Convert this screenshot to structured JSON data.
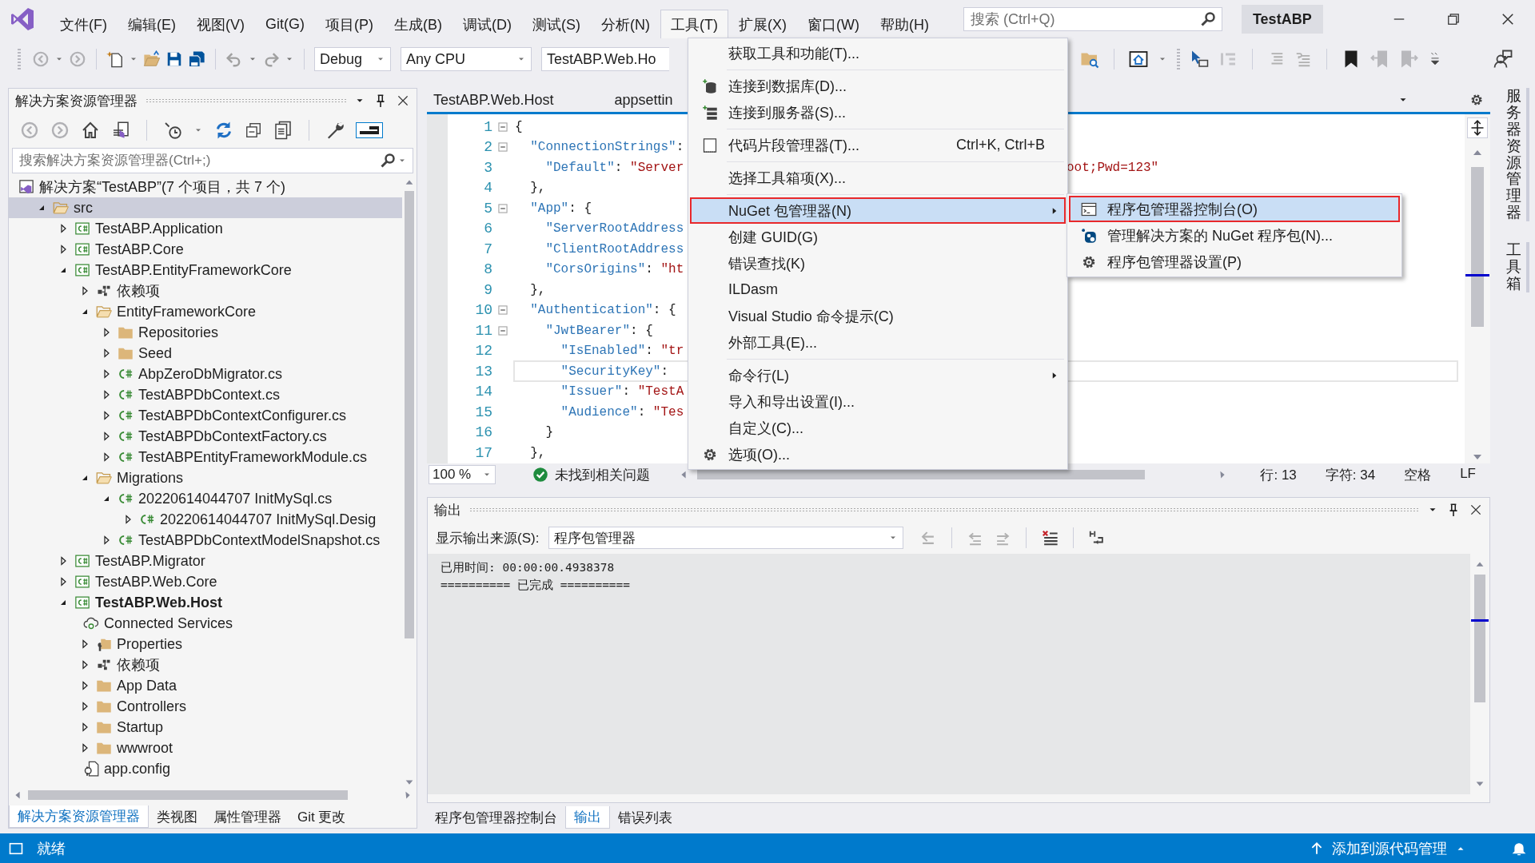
{
  "title_bar": {
    "menus": [
      {
        "label": "文件(F)",
        "selected": false
      },
      {
        "label": "编辑(E)",
        "selected": false
      },
      {
        "label": "视图(V)",
        "selected": false
      },
      {
        "label": "Git(G)",
        "selected": false
      },
      {
        "label": "项目(P)",
        "selected": false
      },
      {
        "label": "生成(B)",
        "selected": false
      },
      {
        "label": "调试(D)",
        "selected": false
      },
      {
        "label": "测试(S)",
        "selected": false
      },
      {
        "label": "分析(N)",
        "selected": false
      },
      {
        "label": "工具(T)",
        "selected": true
      },
      {
        "label": "扩展(X)",
        "selected": false
      },
      {
        "label": "窗口(W)",
        "selected": false
      },
      {
        "label": "帮助(H)",
        "selected": false
      }
    ],
    "search": {
      "placeholder": "搜索 (Ctrl+Q)"
    },
    "solution_name": "TestABP"
  },
  "toolbar": {
    "configuration": "Debug",
    "platform": "Any CPU",
    "startup_project": "TestABP.Web.Ho"
  },
  "solution_explorer": {
    "title": "解决方案资源管理器",
    "preview_toggle": {
      "on": true
    },
    "search": {
      "placeholder": "搜索解决方案资源管理器(Ctrl+;)"
    },
    "tree": [
      {
        "label": "解决方案“TestABP”(7 个项目，共 7 个)",
        "kind": "solution",
        "selected": false,
        "startup": false,
        "children": [
          {
            "label": "src",
            "kind": "folder",
            "expanded": true,
            "selected": true,
            "startup": false,
            "children": [
              {
                "label": "TestABP.Application",
                "kind": "project",
                "expanded": false,
                "selected": false,
                "startup": false
              },
              {
                "label": "TestABP.Core",
                "kind": "project",
                "expanded": false,
                "selected": false,
                "startup": false
              },
              {
                "label": "TestABP.EntityFrameworkCore",
                "kind": "project",
                "expanded": true,
                "selected": false,
                "startup": false,
                "children": [
                  {
                    "label": "依赖项",
                    "kind": "dependencies",
                    "expanded": false,
                    "selected": false,
                    "startup": false
                  },
                  {
                    "label": "EntityFrameworkCore",
                    "kind": "folder",
                    "expanded": true,
                    "selected": false,
                    "startup": false,
                    "children": [
                      {
                        "label": "Repositories",
                        "kind": "folder",
                        "expanded": false,
                        "selected": false,
                        "startup": false
                      },
                      {
                        "label": "Seed",
                        "kind": "folder",
                        "expanded": false,
                        "selected": false,
                        "startup": false
                      },
                      {
                        "label": "AbpZeroDbMigrator.cs",
                        "kind": "code",
                        "expanded": false,
                        "selected": false,
                        "startup": false
                      },
                      {
                        "label": "TestABPDbContext.cs",
                        "kind": "code",
                        "expanded": false,
                        "selected": false,
                        "startup": false
                      },
                      {
                        "label": "TestABPDbContextConfigurer.cs",
                        "kind": "code",
                        "expanded": false,
                        "selected": false,
                        "startup": false
                      },
                      {
                        "label": "TestABPDbContextFactory.cs",
                        "kind": "code",
                        "expanded": false,
                        "selected": false,
                        "startup": false
                      },
                      {
                        "label": "TestABPEntityFrameworkModule.cs",
                        "kind": "code",
                        "expanded": false,
                        "selected": false,
                        "startup": false
                      }
                    ]
                  },
                  {
                    "label": "Migrations",
                    "kind": "folder",
                    "expanded": true,
                    "selected": false,
                    "startup": false,
                    "children": [
                      {
                        "label": "20220614044707 InitMySql.cs",
                        "kind": "code",
                        "expanded": true,
                        "selected": false,
                        "startup": false,
                        "children": [
                          {
                            "label": "20220614044707 InitMySql.Desig",
                            "kind": "code",
                            "expanded": false,
                            "selected": false,
                            "startup": false
                          }
                        ]
                      },
                      {
                        "label": "TestABPDbContextModelSnapshot.cs",
                        "kind": "code",
                        "expanded": false,
                        "selected": false,
                        "startup": false
                      }
                    ]
                  }
                ]
              },
              {
                "label": "TestABP.Migrator",
                "kind": "project",
                "expanded": false,
                "selected": false,
                "startup": false
              },
              {
                "label": "TestABP.Web.Core",
                "kind": "project",
                "expanded": false,
                "selected": false,
                "startup": false
              },
              {
                "label": "TestABP.Web.Host",
                "kind": "project",
                "expanded": true,
                "selected": false,
                "startup": true,
                "children": [
                  {
                    "label": "Connected Services",
                    "kind": "connected",
                    "selected": false,
                    "startup": false
                  },
                  {
                    "label": "Properties",
                    "kind": "properties",
                    "expanded": false,
                    "selected": false,
                    "startup": false
                  },
                  {
                    "label": "依赖项",
                    "kind": "dependencies",
                    "expanded": false,
                    "selected": false,
                    "startup": false
                  },
                  {
                    "label": "App Data",
                    "kind": "folder",
                    "expanded": false,
                    "selected": false,
                    "startup": false
                  },
                  {
                    "label": "Controllers",
                    "kind": "folder",
                    "expanded": false,
                    "selected": false,
                    "startup": false
                  },
                  {
                    "label": "Startup",
                    "kind": "folder",
                    "expanded": false,
                    "selected": false,
                    "startup": false
                  },
                  {
                    "label": "wwwroot",
                    "kind": "folder",
                    "expanded": false,
                    "selected": false,
                    "startup": false
                  },
                  {
                    "label": "app.config",
                    "kind": "config",
                    "selected": false,
                    "startup": false
                  }
                ]
              }
            ]
          }
        ]
      }
    ],
    "tabs": [
      {
        "label": "解决方案资源管理器",
        "selected": true
      },
      {
        "label": "类视图",
        "selected": false
      },
      {
        "label": "属性管理器",
        "selected": false
      },
      {
        "label": "Git 更改",
        "selected": false
      }
    ]
  },
  "editor": {
    "tabs": [
      {
        "label": "TestABP.Web.Host"
      },
      {
        "label": "appsettin"
      }
    ],
    "lines": [
      {
        "number": "1",
        "fold": true,
        "current": false,
        "segments": [
          {
            "text": "{",
            "kind": "punct"
          }
        ]
      },
      {
        "number": "2",
        "fold": true,
        "current": false,
        "segments": [
          {
            "text": "  \"ConnectionStrings\"",
            "kind": "key"
          },
          {
            "text": ":",
            "kind": "punct"
          }
        ]
      },
      {
        "number": "3",
        "fold": false,
        "current": false,
        "segments": [
          {
            "text": "    \"Default\"",
            "kind": "key"
          },
          {
            "text": ": ",
            "kind": "punct"
          },
          {
            "text": "\"Server",
            "kind": "string"
          }
        ],
        "tail": {
          "text": "oot;Pwd=123\"",
          "kind": "string"
        }
      },
      {
        "number": "4",
        "fold": false,
        "current": false,
        "segments": [
          {
            "text": "  },",
            "kind": "punct"
          }
        ]
      },
      {
        "number": "5",
        "fold": true,
        "current": false,
        "segments": [
          {
            "text": "  \"App\"",
            "kind": "key"
          },
          {
            "text": ": {",
            "kind": "punct"
          }
        ]
      },
      {
        "number": "6",
        "fold": false,
        "current": false,
        "segments": [
          {
            "text": "    \"ServerRootAddress",
            "kind": "key"
          }
        ]
      },
      {
        "number": "7",
        "fold": false,
        "current": false,
        "segments": [
          {
            "text": "    \"ClientRootAddress",
            "kind": "key"
          }
        ]
      },
      {
        "number": "8",
        "fold": false,
        "current": false,
        "segments": [
          {
            "text": "    \"CorsOrigins\"",
            "kind": "key"
          },
          {
            "text": ": ",
            "kind": "punct"
          },
          {
            "text": "\"ht",
            "kind": "string"
          }
        ]
      },
      {
        "number": "9",
        "fold": false,
        "current": false,
        "segments": [
          {
            "text": "  },",
            "kind": "punct"
          }
        ]
      },
      {
        "number": "10",
        "fold": true,
        "current": false,
        "segments": [
          {
            "text": "  \"Authentication\"",
            "kind": "key"
          },
          {
            "text": ": {",
            "kind": "punct"
          }
        ]
      },
      {
        "number": "11",
        "fold": true,
        "current": false,
        "segments": [
          {
            "text": "    \"JwtBearer\"",
            "kind": "key"
          },
          {
            "text": ": {",
            "kind": "punct"
          }
        ]
      },
      {
        "number": "12",
        "fold": false,
        "current": false,
        "segments": [
          {
            "text": "      \"IsEnabled\"",
            "kind": "key"
          },
          {
            "text": ": ",
            "kind": "punct"
          },
          {
            "text": "\"tr",
            "kind": "string"
          }
        ]
      },
      {
        "number": "13",
        "fold": false,
        "current": true,
        "segments": [
          {
            "text": "      \"SecurityKey\"",
            "kind": "key"
          },
          {
            "text": ":",
            "kind": "punct"
          }
        ]
      },
      {
        "number": "14",
        "fold": false,
        "current": false,
        "segments": [
          {
            "text": "      \"Issuer\"",
            "kind": "key"
          },
          {
            "text": ": ",
            "kind": "punct"
          },
          {
            "text": "\"TestA",
            "kind": "string"
          }
        ]
      },
      {
        "number": "15",
        "fold": false,
        "current": false,
        "segments": [
          {
            "text": "      \"Audience\"",
            "kind": "key"
          },
          {
            "text": ": ",
            "kind": "punct"
          },
          {
            "text": "\"Tes",
            "kind": "string"
          }
        ]
      },
      {
        "number": "16",
        "fold": false,
        "current": false,
        "segments": [
          {
            "text": "    }",
            "kind": "punct"
          }
        ]
      },
      {
        "number": "17",
        "fold": false,
        "current": false,
        "segments": [
          {
            "text": "  },",
            "kind": "punct"
          }
        ]
      }
    ],
    "zoom": "100 %",
    "issues": "未找到相关问题",
    "position": {
      "line": "行: 13",
      "column": "字符: 34",
      "indent": "空格",
      "line_ending": "LF"
    }
  },
  "output": {
    "title": "输出",
    "source_label": "显示输出来源(S):",
    "source": "程序包管理器",
    "lines": [
      "已用时间: 00:00:00.4938378",
      "========== 已完成 =========="
    ],
    "tabs": [
      {
        "label": "程序包管理器控制台",
        "selected": false
      },
      {
        "label": "输出",
        "selected": true
      },
      {
        "label": "错误列表",
        "selected": false
      }
    ]
  },
  "side_tabs": [
    {
      "label": "服务器资源管理器"
    },
    {
      "label": "工具箱"
    }
  ],
  "tools_menu": {
    "items": [
      {
        "kind": "item",
        "label": "获取工具和功能(T)...",
        "selected": false,
        "outlined": false,
        "submenu": false
      },
      {
        "kind": "separator"
      },
      {
        "kind": "item",
        "label": "连接到数据库(D)...",
        "selected": false,
        "outlined": false,
        "submenu": false
      },
      {
        "kind": "item",
        "label": "连接到服务器(S)...",
        "selected": false,
        "outlined": false,
        "submenu": false
      },
      {
        "kind": "separator"
      },
      {
        "kind": "item",
        "label": "代码片段管理器(T)...",
        "shortcut": "Ctrl+K, Ctrl+B",
        "selected": false,
        "outlined": false,
        "submenu": false
      },
      {
        "kind": "separator"
      },
      {
        "kind": "item",
        "label": "选择工具箱项(X)...",
        "selected": false,
        "outlined": false,
        "submenu": false
      },
      {
        "kind": "separator"
      },
      {
        "kind": "item",
        "label": "NuGet 包管理器(N)",
        "selected": true,
        "outlined": true,
        "submenu": true
      },
      {
        "kind": "item",
        "label": "创建 GUID(G)",
        "selected": false,
        "outlined": false,
        "submenu": false
      },
      {
        "kind": "item",
        "label": "错误查找(K)",
        "selected": false,
        "outlined": false,
        "submenu": false
      },
      {
        "kind": "item",
        "label": "ILDasm",
        "selected": false,
        "outlined": false,
        "submenu": false
      },
      {
        "kind": "item",
        "label": "Visual Studio 命令提示(C)",
        "selected": false,
        "outlined": false,
        "submenu": false
      },
      {
        "kind": "item",
        "label": "外部工具(E)...",
        "selected": false,
        "outlined": false,
        "submenu": false
      },
      {
        "kind": "separator"
      },
      {
        "kind": "item",
        "label": "命令行(L)",
        "selected": false,
        "outlined": false,
        "submenu": true
      },
      {
        "kind": "item",
        "label": "导入和导出设置(I)...",
        "selected": false,
        "outlined": false,
        "submenu": false
      },
      {
        "kind": "item",
        "label": "自定义(C)...",
        "selected": false,
        "outlined": false,
        "submenu": false
      },
      {
        "kind": "item",
        "label": "选项(O)...",
        "selected": false,
        "outlined": false,
        "submenu": false
      }
    ]
  },
  "nuget_submenu": {
    "items": [
      {
        "kind": "item",
        "label": "程序包管理器控制台(O)",
        "selected": true,
        "outlined": true,
        "submenu": false
      },
      {
        "kind": "item",
        "label": "管理解决方案的 NuGet 程序包(N)...",
        "selected": false,
        "outlined": false,
        "submenu": false
      },
      {
        "kind": "item",
        "label": "程序包管理器设置(P)",
        "selected": false,
        "outlined": false,
        "submenu": false
      }
    ]
  },
  "status_bar": {
    "text": "就绪",
    "source_control": "添加到源代码管理"
  }
}
